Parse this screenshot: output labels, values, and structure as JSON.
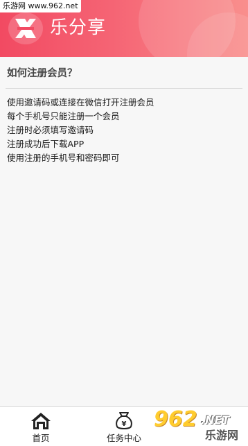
{
  "watermark": "乐游网 www.962.net",
  "header": {
    "app_title": "乐分享"
  },
  "article": {
    "question": "如何注册会员？",
    "lines": [
      "使用邀请码或连接在微信打开注册会员",
      "每个手机号只能注册一个会员",
      "注册时必须填写邀请码",
      "注册成功后下载APP",
      "使用注册的手机号和密码即可"
    ]
  },
  "tabbar": {
    "tabs": [
      {
        "label": "首页",
        "icon": "home-icon"
      },
      {
        "label": "任务中心",
        "icon": "money-bag-icon"
      }
    ]
  },
  "brand_badge": {
    "number": "962",
    "net": ".NET",
    "name": "乐游网"
  },
  "colors": {
    "header_start": "#f24a62",
    "header_end": "#f98f8d",
    "badge_yellow": "#ffcc2e"
  }
}
